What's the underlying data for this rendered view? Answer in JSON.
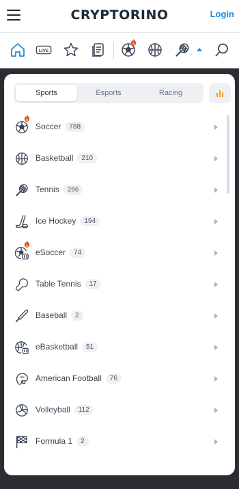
{
  "header": {
    "logo": "CRYPTORINO",
    "login_label": "Login"
  },
  "sportbar": {
    "icons": [
      "home-icon",
      "live-icon",
      "star-icon",
      "betslip-icon",
      "soccer-icon",
      "basketball-icon",
      "tennis-icon",
      "search-icon"
    ],
    "live_label": "LIVE",
    "accent_color": "#1a8fd6",
    "hot_color": "#e8452c"
  },
  "panel": {
    "tabs": [
      {
        "label": "Sports",
        "active": true
      },
      {
        "label": "Esports",
        "active": false
      },
      {
        "label": "Racing",
        "active": false
      }
    ],
    "sports": [
      {
        "name": "Soccer",
        "count": "788",
        "icon": "soccer-icon",
        "hot": true
      },
      {
        "name": "Basketball",
        "count": "210",
        "icon": "basketball-icon",
        "hot": false
      },
      {
        "name": "Tennis",
        "count": "266",
        "icon": "tennis-icon",
        "hot": false
      },
      {
        "name": "Ice Hockey",
        "count": "194",
        "icon": "ice-hockey-icon",
        "hot": false
      },
      {
        "name": "eSoccer",
        "count": "74",
        "icon": "esoccer-icon",
        "hot": true
      },
      {
        "name": "Table Tennis",
        "count": "17",
        "icon": "table-tennis-icon",
        "hot": false
      },
      {
        "name": "Baseball",
        "count": "2",
        "icon": "baseball-icon",
        "hot": false
      },
      {
        "name": "eBasketball",
        "count": "51",
        "icon": "ebasketball-icon",
        "hot": false
      },
      {
        "name": "American Football",
        "count": "76",
        "icon": "american-football-icon",
        "hot": false
      },
      {
        "name": "Volleyball",
        "count": "112",
        "icon": "volleyball-icon",
        "hot": false
      },
      {
        "name": "Formula 1",
        "count": "2",
        "icon": "formula-1-icon",
        "hot": false
      }
    ]
  }
}
